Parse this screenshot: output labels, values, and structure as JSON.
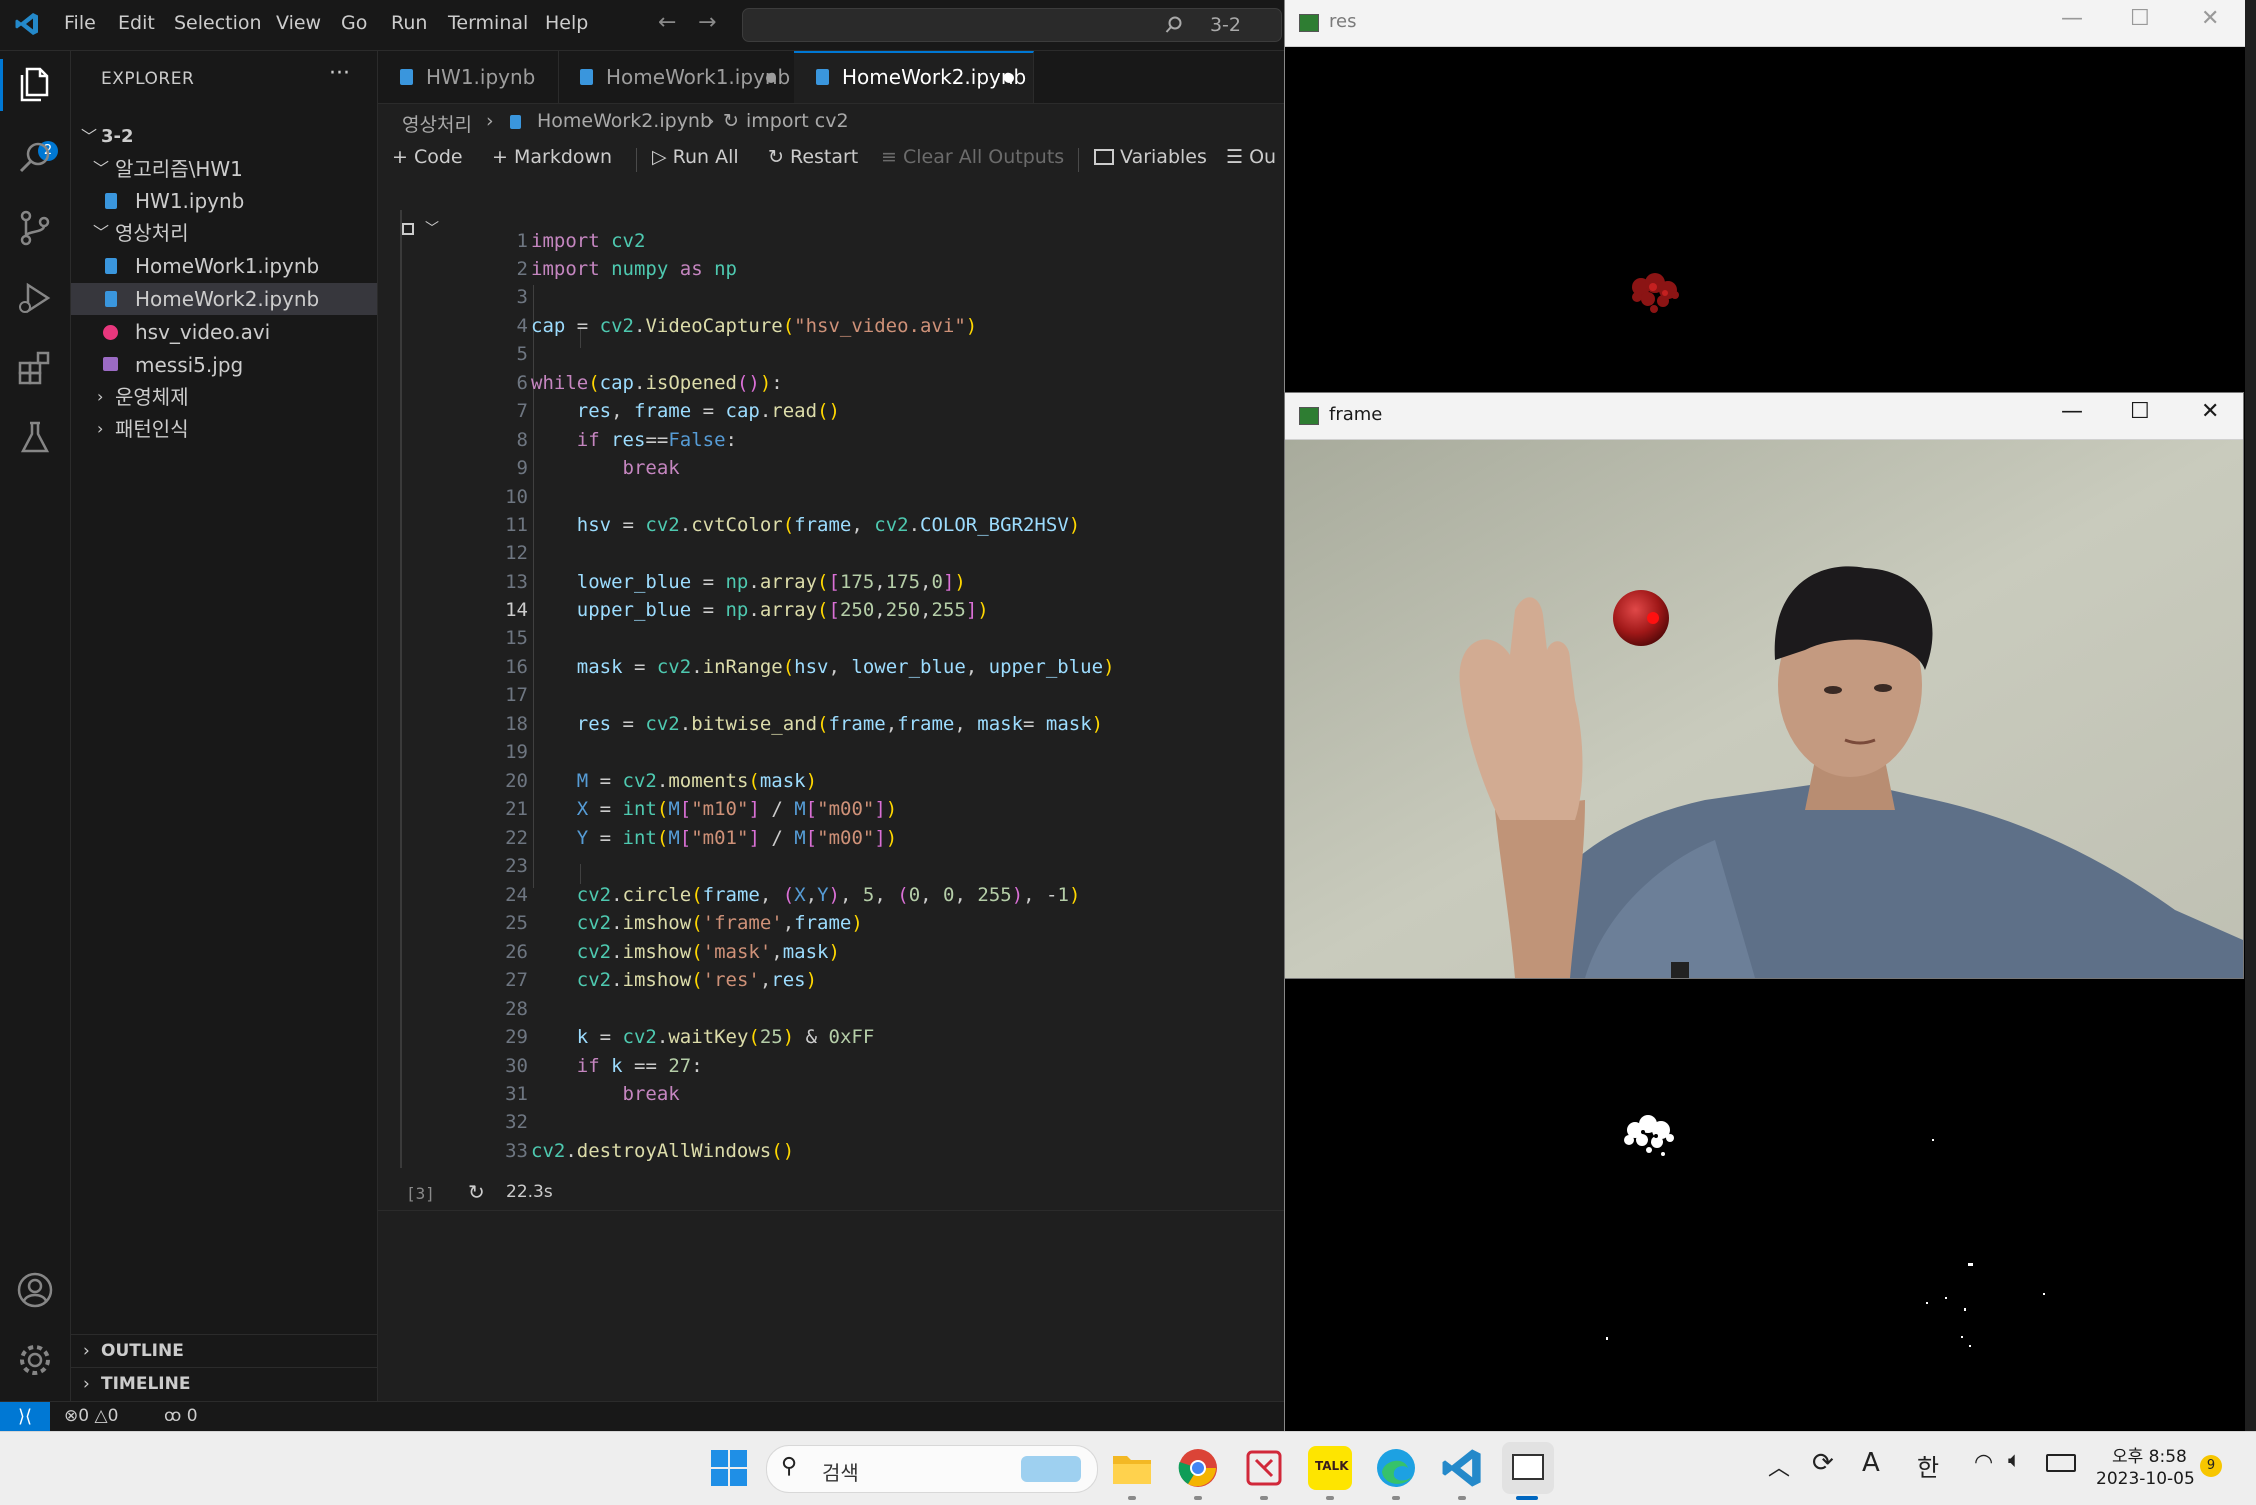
{
  "menu": [
    "File",
    "Edit",
    "Selection",
    "View",
    "Go",
    "Run",
    "Terminal",
    "Help"
  ],
  "command_center": "3-2",
  "activity_badge": "2",
  "sidebar": {
    "title": "EXPLORER",
    "more": "···",
    "tree": [
      {
        "label": "3-2",
        "type": "folder-open",
        "depth": 0
      },
      {
        "label": "알고리즘\\HW1",
        "type": "folder-open",
        "depth": 1
      },
      {
        "label": "HW1.ipynb",
        "type": "notebook",
        "depth": 2
      },
      {
        "label": "영상처리",
        "type": "folder-open",
        "depth": 1
      },
      {
        "label": "HomeWork1.ipynb",
        "type": "notebook",
        "depth": 2
      },
      {
        "label": "HomeWork2.ipynb",
        "type": "notebook",
        "depth": 2,
        "selected": true
      },
      {
        "label": "hsv_video.avi",
        "type": "video",
        "depth": 2
      },
      {
        "label": "messi5.jpg",
        "type": "image",
        "depth": 2
      },
      {
        "label": "운영체제",
        "type": "folder-closed",
        "depth": 1
      },
      {
        "label": "패턴인식",
        "type": "folder-closed",
        "depth": 1
      }
    ],
    "outline": "OUTLINE",
    "timeline": "TIMELINE"
  },
  "tabs": [
    {
      "label": "HW1.ipynb",
      "dirty": false,
      "active": false
    },
    {
      "label": "HomeWork1.ipynb",
      "dirty": true,
      "active": false
    },
    {
      "label": "HomeWork2.ipynb",
      "dirty": true,
      "active": true
    }
  ],
  "breadcrumb": [
    "영상처리",
    "HomeWork2.ipynb",
    "import cv2"
  ],
  "toolbar": {
    "code": "Code",
    "markdown": "Markdown",
    "run_all": "Run All",
    "restart": "Restart",
    "clear_outputs": "Clear All Outputs",
    "variables": "Variables",
    "outline": "Ou"
  },
  "cell": {
    "current_line": 14,
    "exec_count": "[3]",
    "exec_time": "22.3s"
  },
  "status": {
    "errors": "0",
    "warnings": "0",
    "ports": "0"
  },
  "windows": {
    "res": {
      "title": "res"
    },
    "frame": {
      "title": "frame"
    }
  },
  "taskbar": {
    "search_placeholder": "검색",
    "ime_a": "A",
    "ime_han": "한",
    "time": "오후 8:58",
    "date": "2023-10-05",
    "notif_count": "9"
  },
  "colors": {
    "accent": "#0078d4",
    "bg": "#1f1f1f",
    "sidebar": "#181818"
  }
}
